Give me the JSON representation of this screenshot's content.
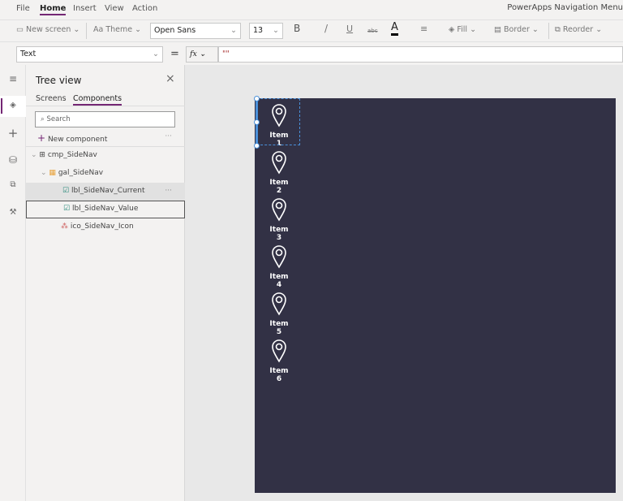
{
  "menubar": {
    "items": [
      "File",
      "Home",
      "Insert",
      "View",
      "Action"
    ],
    "active": "Home",
    "app_title": "PowerApps Navigation Menu"
  },
  "ribbon": {
    "new_screen": "New screen",
    "theme": "Theme",
    "font": "Open Sans",
    "font_size": "13",
    "bold": "B",
    "italic": "/",
    "underline": "U",
    "strike": "abc",
    "font_color": "A",
    "fill": "Fill",
    "border": "Border",
    "reorder": "Reorder"
  },
  "formula": {
    "property": "Text",
    "equals": "=",
    "fx": "fx",
    "value": "\"\""
  },
  "tree": {
    "title": "Tree view",
    "tabs": [
      "Screens",
      "Components"
    ],
    "active_tab": "Components",
    "search_placeholder": "Search",
    "new_component": "New component",
    "more": "···",
    "nodes": [
      {
        "label": "cmp_SideNav",
        "level": 0
      },
      {
        "label": "gal_SideNav",
        "level": 1
      },
      {
        "label": "lbl_SideNav_Current",
        "level": 2
      },
      {
        "label": "lbl_SideNav_Value",
        "level": 2
      },
      {
        "label": "ico_SideNav_Icon",
        "level": 2
      }
    ]
  },
  "canvas": {
    "background": "#323145",
    "items": [
      "Item 1",
      "Item 2",
      "Item 3",
      "Item 4",
      "Item 5",
      "Item 6"
    ],
    "icon": "location-pin-icon"
  },
  "colors": {
    "accent": "#742774",
    "selection": "#4a90d9"
  }
}
